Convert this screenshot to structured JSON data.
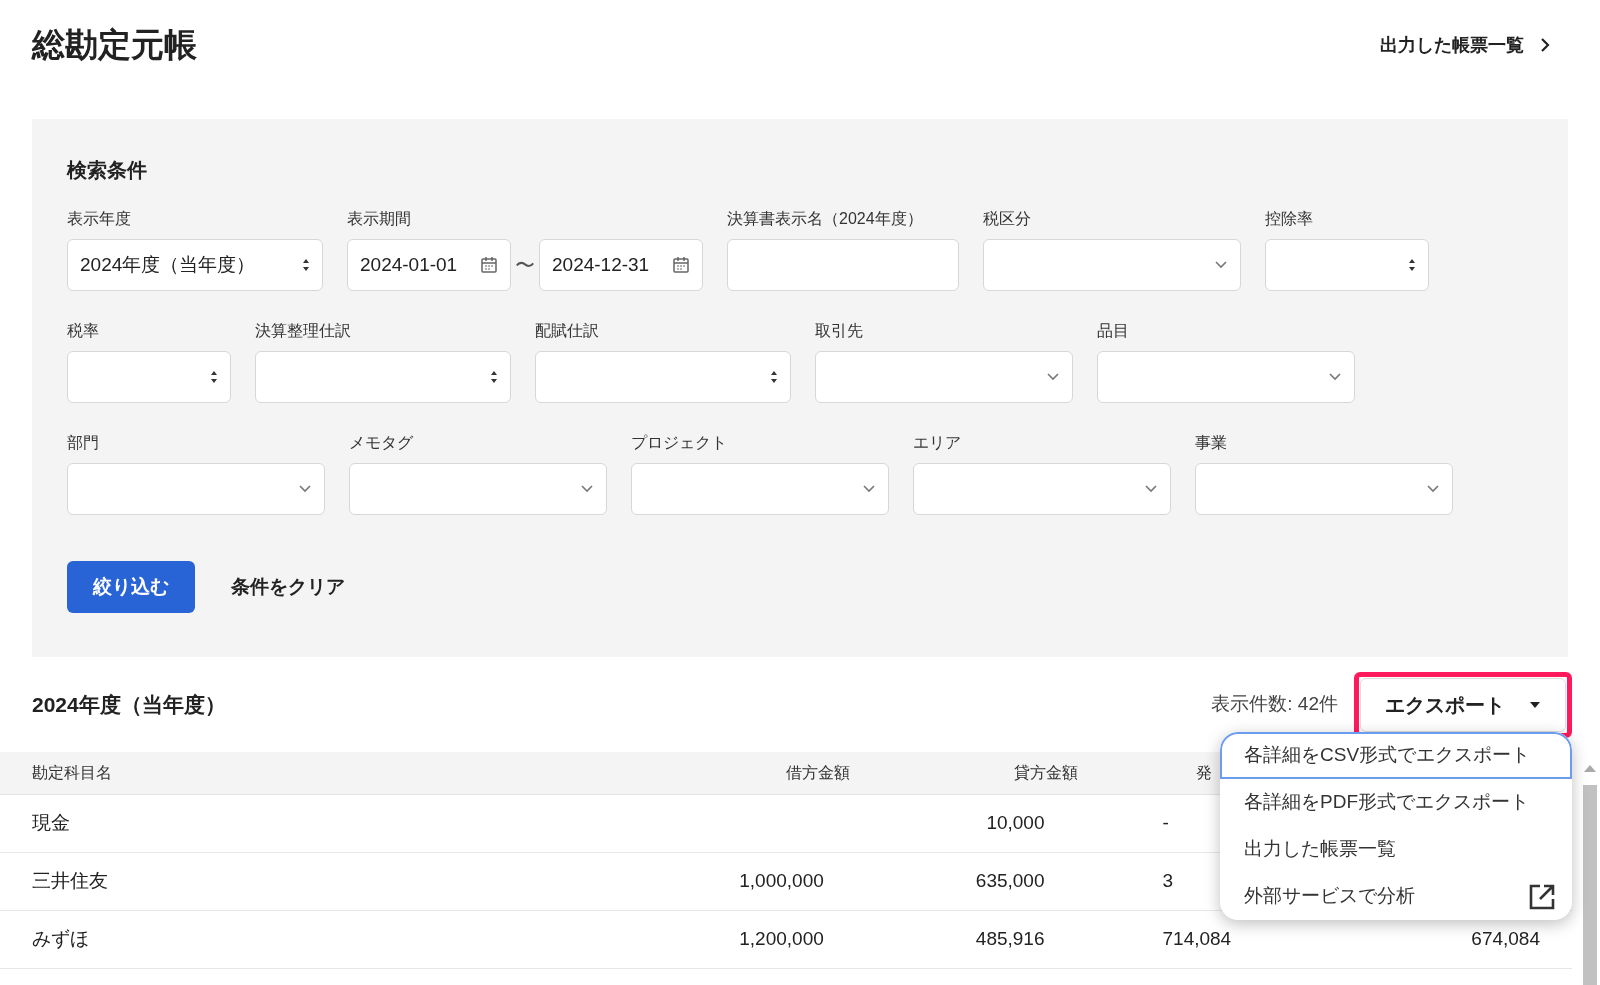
{
  "page": {
    "title": "総勘定元帳",
    "header_link": "出力した帳票一覧"
  },
  "search": {
    "title": "検索条件",
    "rows": [
      [
        {
          "label": "表示年度",
          "kind": "select",
          "value": "2024年度（当年度）"
        },
        {
          "label": "表示期間",
          "kind": "daterange",
          "from": "2024-01-01",
          "to": "2024-12-31",
          "separator": "〜"
        },
        {
          "label": "決算書表示名（2024年度）",
          "kind": "text"
        },
        {
          "label": "税区分",
          "kind": "combo"
        },
        {
          "label": "控除率",
          "kind": "select"
        }
      ],
      [
        {
          "label": "税率",
          "kind": "select"
        },
        {
          "label": "決算整理仕訳",
          "kind": "select"
        },
        {
          "label": "配賦仕訳",
          "kind": "select"
        },
        {
          "label": "取引先",
          "kind": "combo"
        },
        {
          "label": "品目",
          "kind": "combo"
        }
      ],
      [
        {
          "label": "部門",
          "kind": "combo"
        },
        {
          "label": "メモタグ",
          "kind": "combo"
        },
        {
          "label": "プロジェクト",
          "kind": "combo"
        },
        {
          "label": "エリア",
          "kind": "combo"
        },
        {
          "label": "事業",
          "kind": "combo"
        }
      ]
    ],
    "submit": "絞り込む",
    "clear": "条件をクリア"
  },
  "results": {
    "title": "2024年度（当年度）",
    "count": "表示件数: 42件",
    "export_button": {
      "label": "エクスポート",
      "highlighted": true
    },
    "menu": [
      {
        "label": "各詳細をCSV形式でエクスポート",
        "selected": true,
        "external": false
      },
      {
        "label": "各詳細をPDF形式でエクスポート",
        "selected": false,
        "external": false
      },
      {
        "label": "出力した帳票一覧",
        "selected": false,
        "external": false
      },
      {
        "label": "外部サービスで分析",
        "selected": false,
        "external": true
      }
    ]
  },
  "table": {
    "columns": [
      "勘定科目名",
      "借方金額",
      "貸方金額",
      "発"
    ],
    "rows": [
      [
        "現金",
        "",
        "10,000",
        "-",
        ""
      ],
      [
        "三井住友",
        "1,000,000",
        "635,000",
        "3",
        ""
      ],
      [
        "みずほ",
        "1,200,000",
        "485,916",
        "714,084",
        "674,084"
      ]
    ]
  }
}
